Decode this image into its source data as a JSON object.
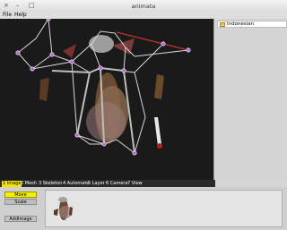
{
  "window": {
    "title": "animata",
    "controls": [
      "×",
      "–",
      "□"
    ]
  },
  "menu": {
    "items": [
      "File",
      "Help"
    ]
  },
  "tree": {
    "root_label": "Indonesian"
  },
  "tabs": [
    {
      "label": "1 Image",
      "active": true
    },
    {
      "label": "2 Mesh",
      "active": false
    },
    {
      "label": "3 Skeleton",
      "active": false
    },
    {
      "label": "4 Automate",
      "active": false
    },
    {
      "label": "5 Layer",
      "active": false
    },
    {
      "label": "6 Camera",
      "active": false
    },
    {
      "label": "7 View",
      "active": false
    }
  ],
  "image_panel": {
    "move_label": "Move",
    "scale_label": "Scale",
    "add_label": "AddImage"
  },
  "colors": {
    "canvas_bg": "#1a1a1a",
    "active_tab": "#f2e400",
    "joint": "#b36ad6",
    "selected_bone": "#c23030"
  }
}
